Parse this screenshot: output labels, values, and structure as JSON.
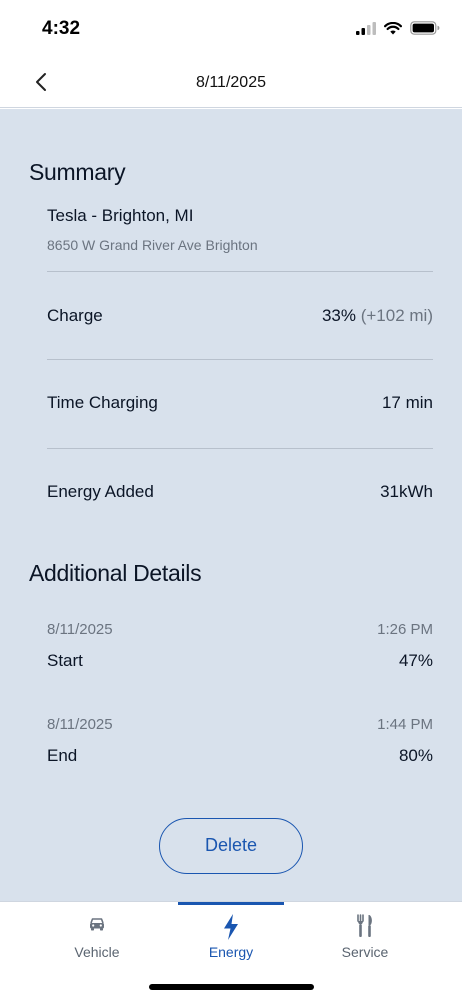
{
  "status_bar": {
    "time": "4:32"
  },
  "nav": {
    "title": "8/11/2025"
  },
  "summary": {
    "heading": "Summary",
    "location_name": "Tesla - Brighton, MI",
    "location_address": "8650 W Grand River Ave Brighton",
    "rows": [
      {
        "label": "Charge",
        "value": "33%",
        "extra": "(+102 mi)"
      },
      {
        "label": "Time Charging",
        "value": "17 min"
      },
      {
        "label": "Energy Added",
        "value": "31kWh"
      }
    ]
  },
  "additional": {
    "heading": "Additional Details",
    "entries": [
      {
        "date": "8/11/2025",
        "time": "1:26 PM",
        "label": "Start",
        "value": "47%"
      },
      {
        "date": "8/11/2025",
        "time": "1:44 PM",
        "label": "End",
        "value": "80%"
      }
    ]
  },
  "actions": {
    "delete_label": "Delete"
  },
  "tabs": [
    {
      "label": "Vehicle",
      "icon": "car-icon",
      "active": false
    },
    {
      "label": "Energy",
      "icon": "lightning-icon",
      "active": true
    },
    {
      "label": "Service",
      "icon": "tools-icon",
      "active": false
    }
  ],
  "colors": {
    "accent": "#1a56b0",
    "background": "#d8e1ec"
  }
}
